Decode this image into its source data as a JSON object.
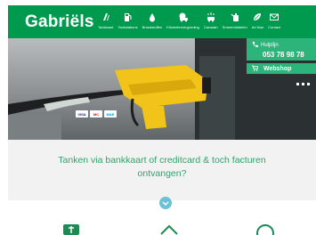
{
  "header": {
    "logo": "Gabriëls",
    "nav": [
      {
        "label": "Tankkaart",
        "icon": "fuel-card-icon"
      },
      {
        "label": "Tankstations",
        "icon": "fuel-pump-icon"
      },
      {
        "label": "Brandstoffen",
        "icon": "oil-drop-icon"
      },
      {
        "label": "Kilometervergoeding",
        "icon": "money-car-icon"
      },
      {
        "label": "Carwash",
        "icon": "car-wash-icon"
      },
      {
        "label": "Smeermiddelen",
        "icon": "oil-can-icon"
      },
      {
        "label": "Ad blue",
        "icon": "leaf-icon"
      },
      {
        "label": "Contact",
        "icon": "envelope-icon"
      }
    ]
  },
  "hero": {
    "contact_label": "Hulplijn",
    "contact_phone": "053 78 98 78",
    "webshop_label": "Webshop",
    "cards": [
      "VISA",
      "MC",
      "MAE"
    ]
  },
  "info": {
    "tagline": "Tanken via bankkaart of creditcard & toch facturen ontvangen?"
  },
  "colors": {
    "brand_green": "#009a4e",
    "accent_green": "#2db47a",
    "tagline_green": "#2fa36b",
    "scroll_button": "#6cc1d6"
  }
}
